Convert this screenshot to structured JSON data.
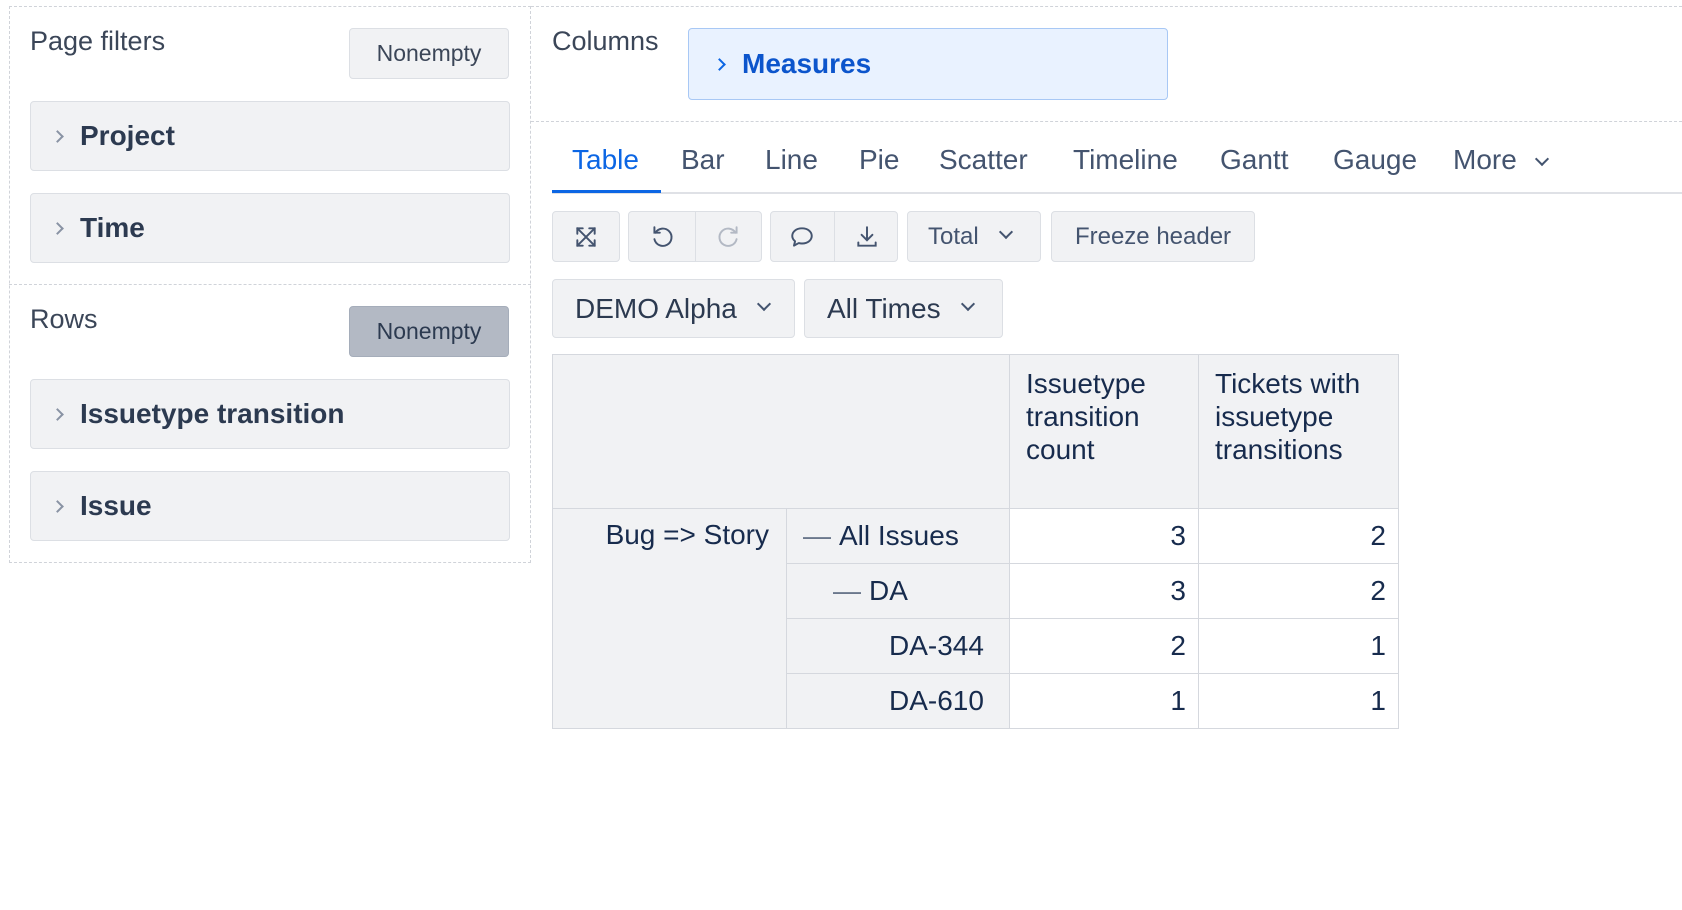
{
  "page_filters": {
    "title": "Page filters",
    "nonempty_label": "Nonempty",
    "items": [
      {
        "label": "Project"
      },
      {
        "label": "Time"
      }
    ]
  },
  "rows": {
    "title": "Rows",
    "nonempty_label": "Nonempty",
    "items": [
      {
        "label": "Issuetype transition"
      },
      {
        "label": "Issue"
      }
    ]
  },
  "columns": {
    "title": "Columns",
    "items": [
      {
        "label": "Measures"
      }
    ]
  },
  "tabs": [
    {
      "label": "Table",
      "active": true
    },
    {
      "label": "Bar"
    },
    {
      "label": "Line"
    },
    {
      "label": "Pie"
    },
    {
      "label": "Scatter"
    },
    {
      "label": "Timeline"
    },
    {
      "label": "Gantt"
    },
    {
      "label": "Gauge"
    },
    {
      "label": "More"
    }
  ],
  "toolbar": {
    "fullscreen_icon": "expand-arrows-icon",
    "undo_icon": "undo-icon",
    "redo_icon": "redo-icon",
    "comment_icon": "comment-icon",
    "export_icon": "download-icon",
    "total_label": "Total",
    "freeze_label": "Freeze header"
  },
  "filters": {
    "project_value": "DEMO Alpha",
    "time_value": "All Times"
  },
  "table": {
    "columns": [
      "Issuetype transition count",
      "Tickets with issuetype transitions"
    ],
    "group_label": "Bug => Story",
    "rows": [
      {
        "label": "All Issues",
        "level": 0,
        "collapsible": true,
        "values": [
          "3",
          "2"
        ]
      },
      {
        "label": "DA",
        "level": 1,
        "collapsible": true,
        "values": [
          "3",
          "2"
        ]
      },
      {
        "label": "DA-344",
        "level": 2,
        "collapsible": false,
        "values": [
          "2",
          "1"
        ]
      },
      {
        "label": "DA-610",
        "level": 2,
        "collapsible": false,
        "values": [
          "1",
          "1"
        ]
      }
    ]
  },
  "colors": {
    "accent": "#0c66e4",
    "panel_bg": "#f1f2f4",
    "measures_bg": "#e9f2ff"
  }
}
